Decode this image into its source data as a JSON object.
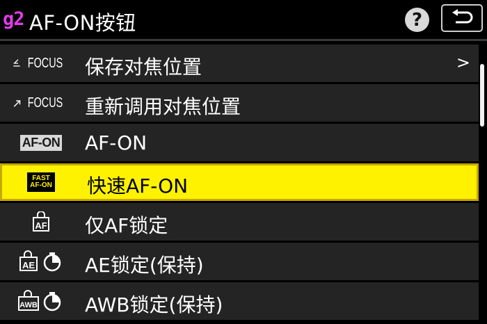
{
  "header": {
    "code": "g2",
    "title": "AF-ON按钮",
    "help_label": "?"
  },
  "menu": {
    "items": [
      {
        "icon": "save-focus-position-icon",
        "icon_text": "FOCUS",
        "label": "保存对焦位置",
        "chevron": ">",
        "selected": false
      },
      {
        "icon": "recall-focus-position-icon",
        "icon_text": "FOCUS",
        "label": "重新调用对焦位置",
        "selected": false
      },
      {
        "icon": "af-on-icon",
        "icon_text": "AF-ON",
        "label": "AF-ON",
        "selected": false
      },
      {
        "icon": "fast-af-on-icon",
        "icon_text_top": "FAST",
        "icon_text_bottom": "AF-ON",
        "label": "快速AF-ON",
        "selected": true
      },
      {
        "icon": "af-lock-icon",
        "icon_text": "AF",
        "label": "仅AF锁定",
        "selected": false
      },
      {
        "icon": "ae-lock-hold-icon",
        "icon_text": "AE",
        "label": "AE锁定(保持)",
        "selected": false
      },
      {
        "icon": "awb-lock-hold-icon",
        "icon_text": "AWB",
        "label": "AWB锁定(保持)",
        "selected": false
      }
    ]
  },
  "colors": {
    "highlight": "#fff200",
    "code_color": "#e13ce6",
    "row_bg": "#242424"
  }
}
